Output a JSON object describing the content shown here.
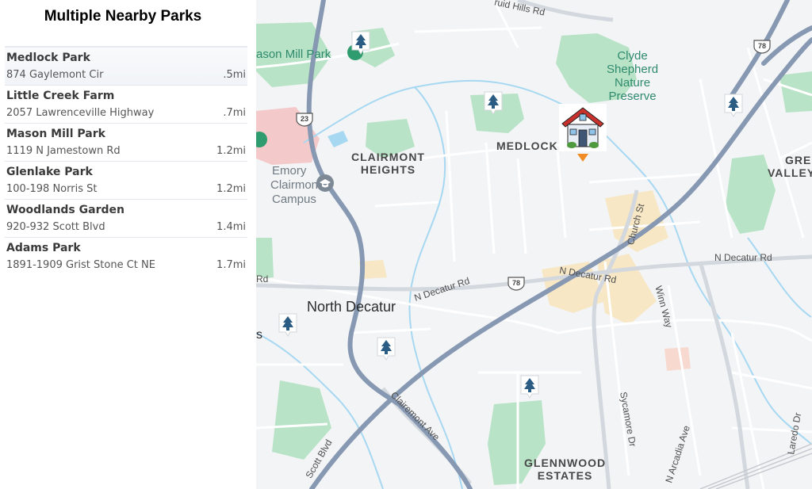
{
  "title": "Multiple Nearby Parks",
  "parks": [
    {
      "name": "Medlock Park",
      "address": "874 Gaylemont Cir",
      "distance": ".5mi"
    },
    {
      "name": "Little Creek Farm",
      "address": "2057 Lawrenceville Highway",
      "distance": ".7mi"
    },
    {
      "name": "Mason Mill Park",
      "address": "1119 N Jamestown Rd",
      "distance": "1.2mi"
    },
    {
      "name": "Glenlake Park",
      "address": "100-198 Norris St",
      "distance": "1.2mi"
    },
    {
      "name": "Woodlands Garden",
      "address": "920-932 Scott Blvd",
      "distance": "1.4mi"
    },
    {
      "name": "Adams Park",
      "address": "1891-1909 Grist Stone Ct NE",
      "distance": "1.7mi"
    }
  ],
  "map": {
    "areas": {
      "clairmont_1": "CLAIRMONT",
      "clairmont_2": "HEIGHTS",
      "medlock": "MEDLOCK",
      "glennwood_1": "GLENNWOOD",
      "glennwood_2": "ESTATES",
      "greater_valley_1": "GRE",
      "greater_valley_2": "VALLEY"
    },
    "city": "North Decatur",
    "city_edge": "s",
    "parks": {
      "mason_mill": "ason Mill Park",
      "clyde_1": "Clyde",
      "clyde_2": "Shepherd",
      "clyde_3": "Nature",
      "clyde_4": "Preserve"
    },
    "campus": {
      "line1": "Emory",
      "line2": "Clairmont",
      "line3": "Campus"
    },
    "roads": {
      "druid_hills": "ruid Hills Rd",
      "n_decatur_west": "N Decatur Rd",
      "n_decatur_mid": "N Decatur Rd",
      "n_decatur_east": "N Decatur Rd",
      "rd_west": "Rd",
      "church_st": "Church St",
      "winn_way": "Winn Way",
      "clairemont_ave": "Clairemont Ave",
      "scott_blvd": "Scott Blvd",
      "sycamore_dr": "Sycamore Dr",
      "n_arcadia_ave": "N Arcadia Ave",
      "laredo_dr": "Laredo Dr"
    },
    "shields": {
      "us23": "23",
      "us78_north": "78",
      "us78_mid": "78"
    },
    "colors": {
      "park_green": "#b8e3c6",
      "highway": "#8798b2",
      "water": "#a7d8f2",
      "pin": "#2b5d84",
      "home_marker": "#f08c23"
    }
  }
}
